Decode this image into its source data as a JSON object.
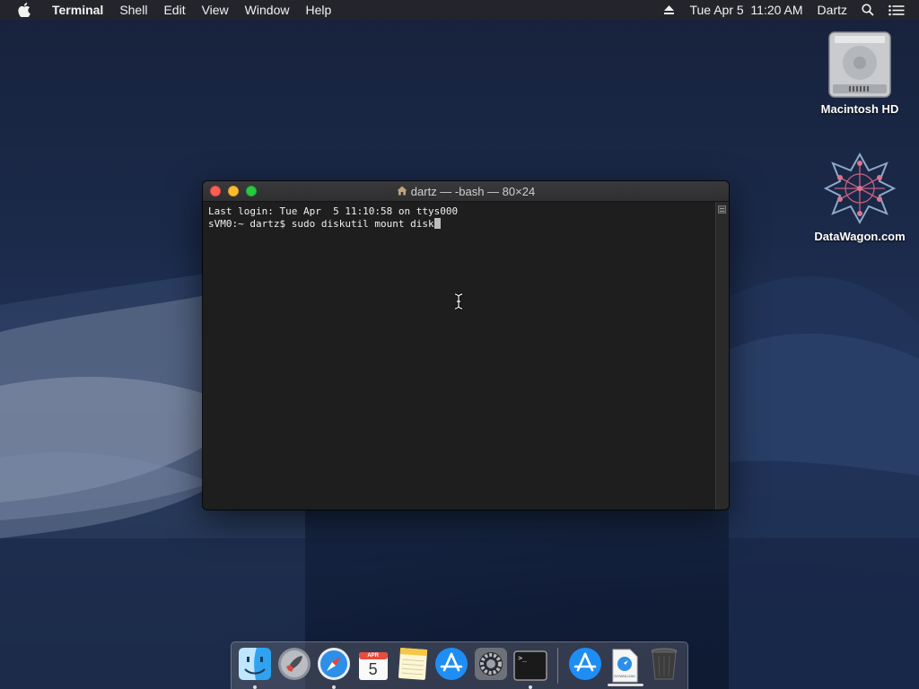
{
  "menubar": {
    "app_name": "Terminal",
    "menus": [
      "Shell",
      "Edit",
      "View",
      "Window",
      "Help"
    ],
    "date_time": "Tue Apr 5  11:20 AM",
    "user": "Dartz"
  },
  "desktop": {
    "icons": [
      {
        "label": "Macintosh HD",
        "icon": "hard-drive-icon"
      },
      {
        "label": "DataWagon.com",
        "icon": "datawagon-logo-icon"
      }
    ]
  },
  "terminal": {
    "title": "dartz — -bash — 80×24",
    "lines": [
      "Last login: Tue Apr  5 11:10:58 on ttys000",
      "sVM0:~ dartz$ sudo diskutil mount disk"
    ]
  },
  "dock": {
    "items": [
      {
        "name": "Finder",
        "icon": "finder-icon",
        "running": true
      },
      {
        "name": "Launchpad",
        "icon": "launchpad-icon",
        "running": false
      },
      {
        "name": "Safari",
        "icon": "safari-icon",
        "running": true
      },
      {
        "name": "Calendar",
        "icon": "calendar-icon",
        "running": false,
        "month": "APR",
        "day": "5"
      },
      {
        "name": "Notes",
        "icon": "notes-icon",
        "running": false
      },
      {
        "name": "App Store",
        "icon": "app-store-icon",
        "running": false
      },
      {
        "name": "System Preferences",
        "icon": "system-preferences-icon",
        "running": false
      },
      {
        "name": "Terminal",
        "icon": "terminal-icon",
        "running": true,
        "prompt": ">_"
      },
      {
        "name": "App Store Downloads",
        "icon": "app-store-icon",
        "running": false
      },
      {
        "name": "Downloads",
        "icon": "download-document-icon",
        "running": false,
        "label": "DOWNLOAD"
      },
      {
        "name": "Trash",
        "icon": "trash-icon",
        "running": false
      }
    ]
  }
}
